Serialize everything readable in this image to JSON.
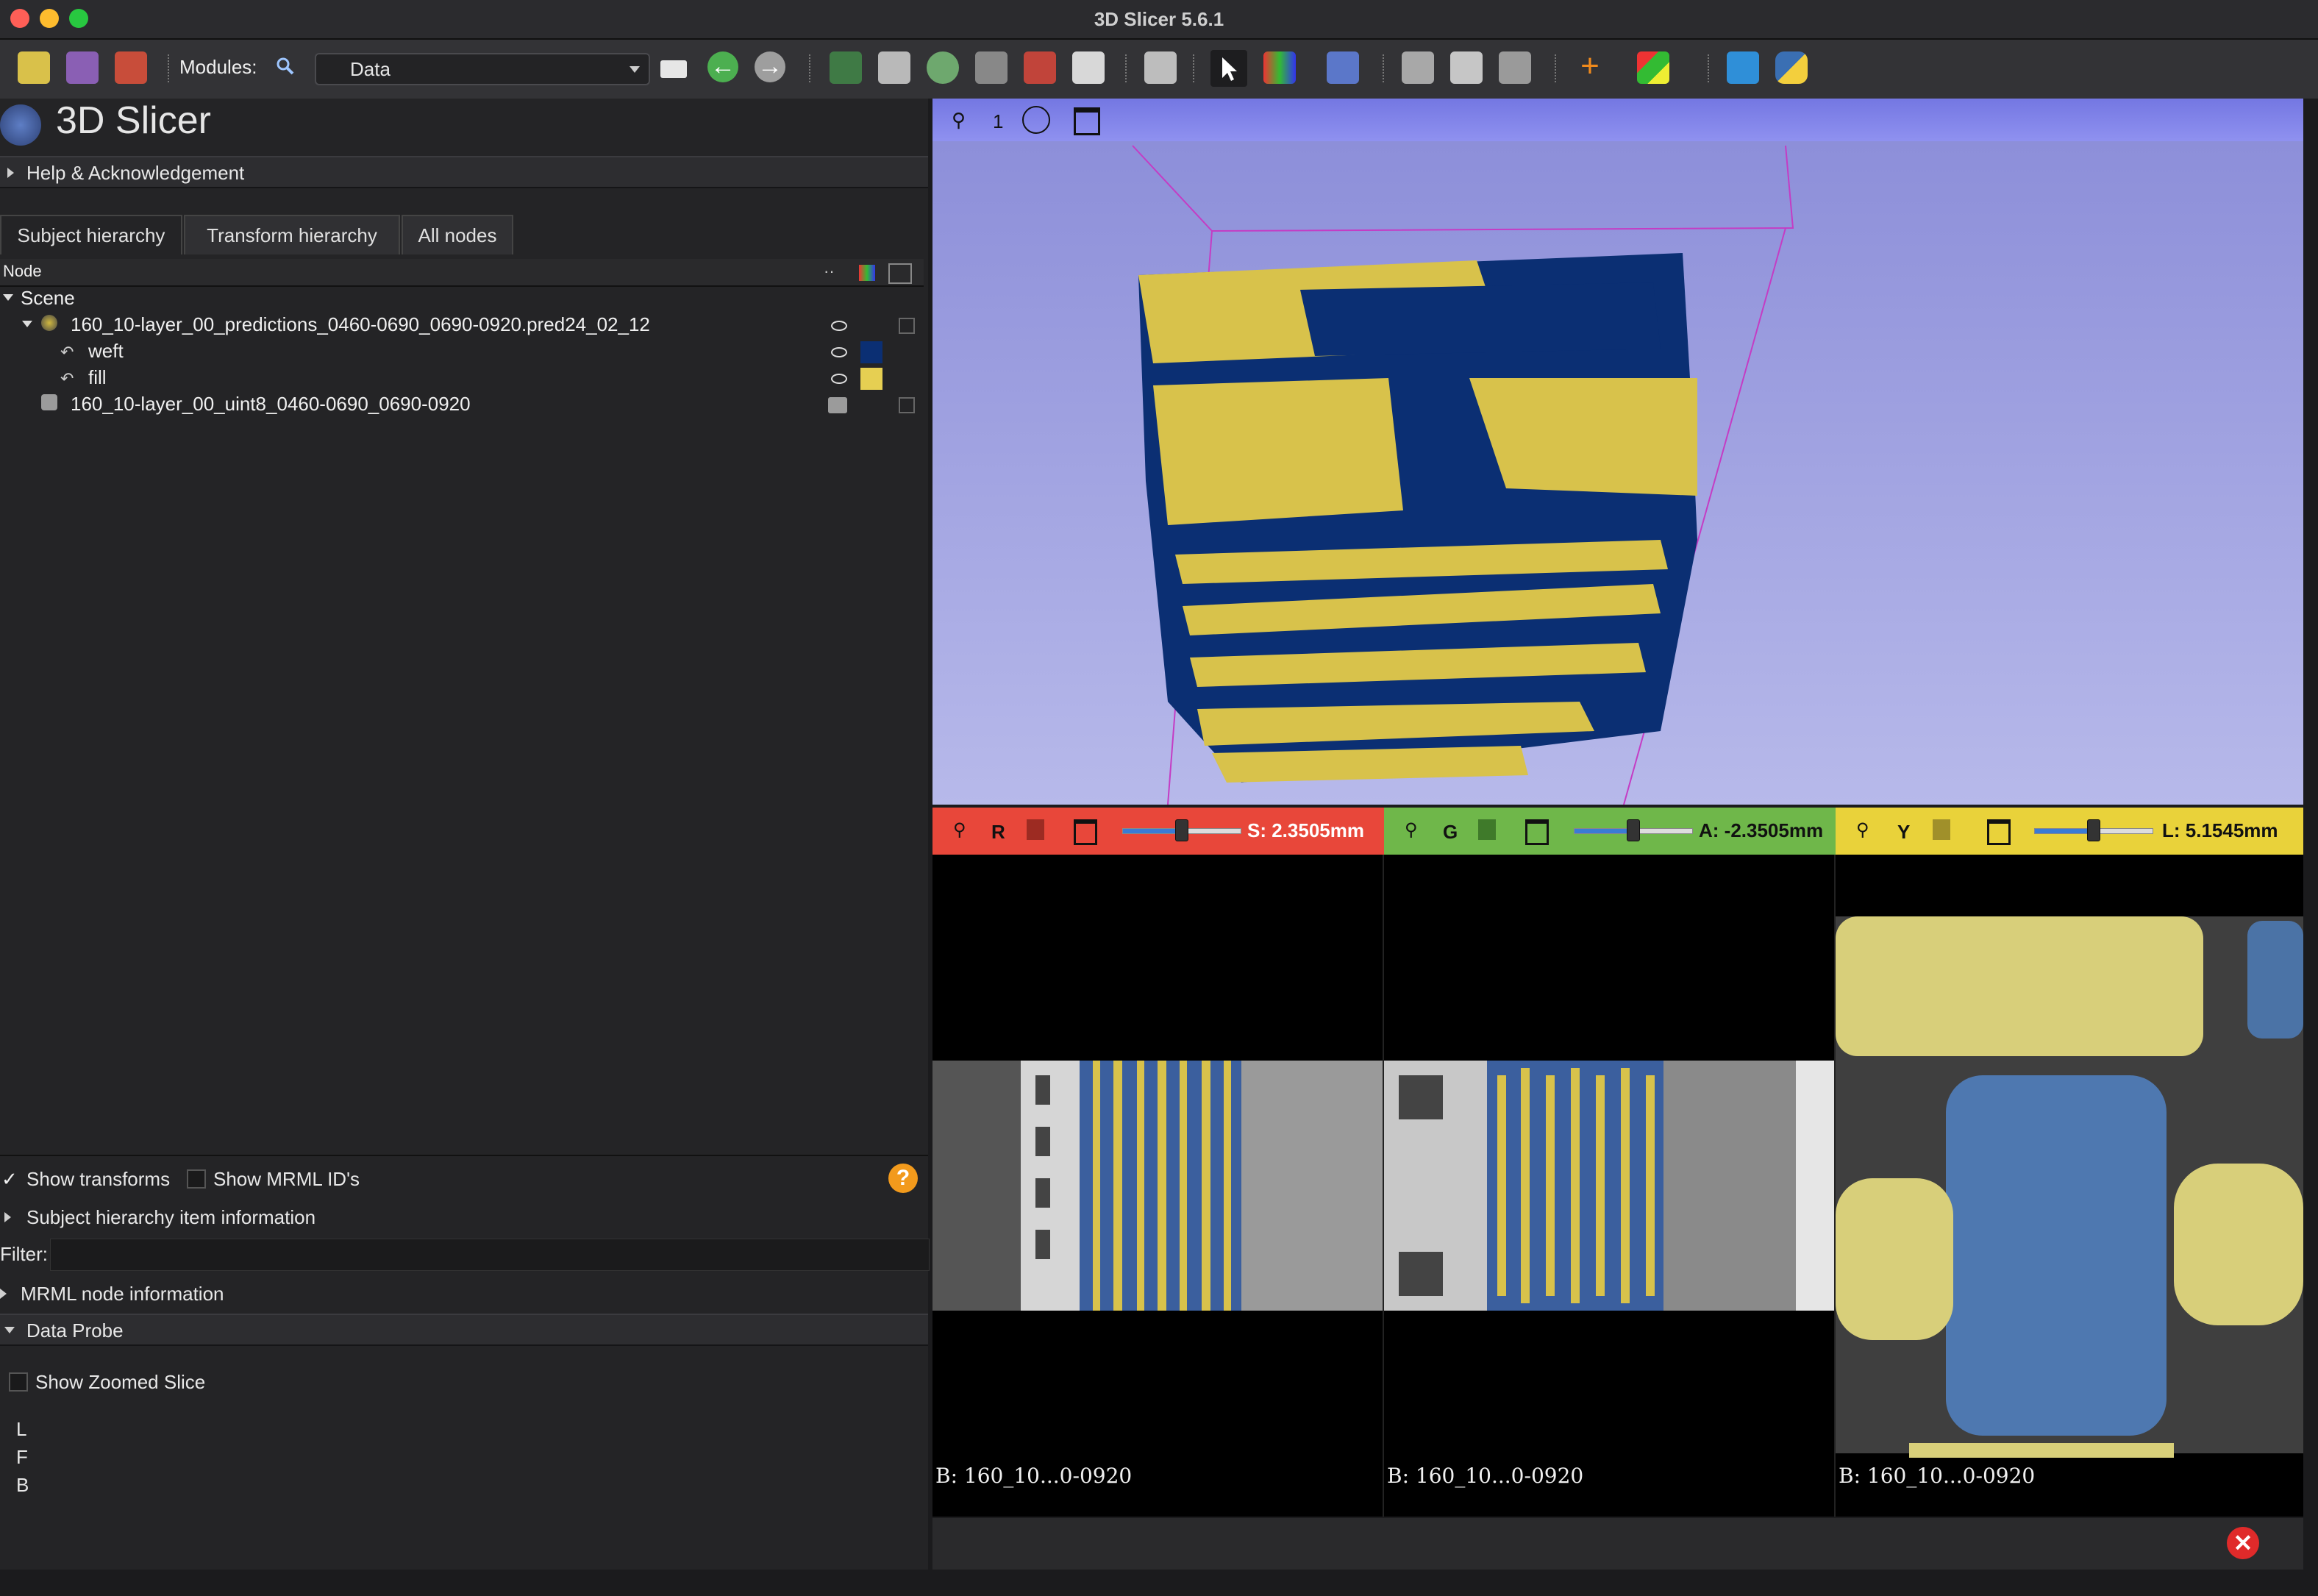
{
  "window": {
    "title": "3D Slicer 5.6.1"
  },
  "toolbar": {
    "modules_label": "Modules:",
    "module_selected": "Data",
    "icons": [
      "data-icon",
      "dcm-icon",
      "save-icon",
      "search-icon",
      "layout-icon",
      "back-arrow-icon",
      "forward-arrow-icon",
      "segment-editor-icon",
      "models-icon",
      "markups-icon",
      "volume-icon",
      "extensions-icon",
      "pen-icon",
      "screen-capture-icon",
      "pointer-icon",
      "window-level-icon",
      "crosshair-icon",
      "camera-icon",
      "sequence-icon",
      "python-icon"
    ]
  },
  "app": {
    "title": "3D Slicer"
  },
  "sections": {
    "help": "Help & Acknowledgement",
    "subject_info": "Subject hierarchy item information",
    "mrml_info": "MRML node information",
    "data_probe": "Data Probe"
  },
  "tabs": [
    {
      "label": "Subject hierarchy",
      "active": true
    },
    {
      "label": "Transform hierarchy",
      "active": false
    },
    {
      "label": "All nodes",
      "active": false
    }
  ],
  "tree": {
    "header": "Node",
    "rows": [
      {
        "label": "Scene",
        "level": 0
      },
      {
        "label": "160_10-layer_00_predictions_0460-0690_0690-0920.pred24_02_12",
        "level": 1
      },
      {
        "label": "weft",
        "level": 2,
        "color": "#0b2f73"
      },
      {
        "label": "fill",
        "level": 2,
        "color": "#e6cf52"
      },
      {
        "label": "160_10-layer_00_uint8_0460-0690_0690-0920",
        "level": 1
      }
    ]
  },
  "options": {
    "show_transforms": "Show transforms",
    "show_transforms_checked": true,
    "show_mrml_ids": "Show MRML ID's",
    "show_mrml_ids_checked": false,
    "filter_label": "Filter:",
    "filter_value": ""
  },
  "data_probe": {
    "zoomed_slice": "Show Zoomed Slice",
    "rows": [
      "L",
      "F",
      "B"
    ]
  },
  "view3d": {
    "label": "1"
  },
  "slices": [
    {
      "letter": "R",
      "value": "S: 2.3505mm",
      "color": "#e8473a",
      "info": "B: 160_10...0-0920",
      "slider": 0.5
    },
    {
      "letter": "G",
      "value": "A: -2.3505mm",
      "color": "#6fb74a",
      "info": "B: 160_10...0-0920",
      "slider": 0.5
    },
    {
      "letter": "Y",
      "value": "L: 5.1545mm",
      "color": "#e9d23a",
      "info": "B: 160_10...0-0920",
      "slider": 0.5
    }
  ],
  "colors": {
    "weft": "#0b2f73",
    "fill": "#e6cf52"
  }
}
